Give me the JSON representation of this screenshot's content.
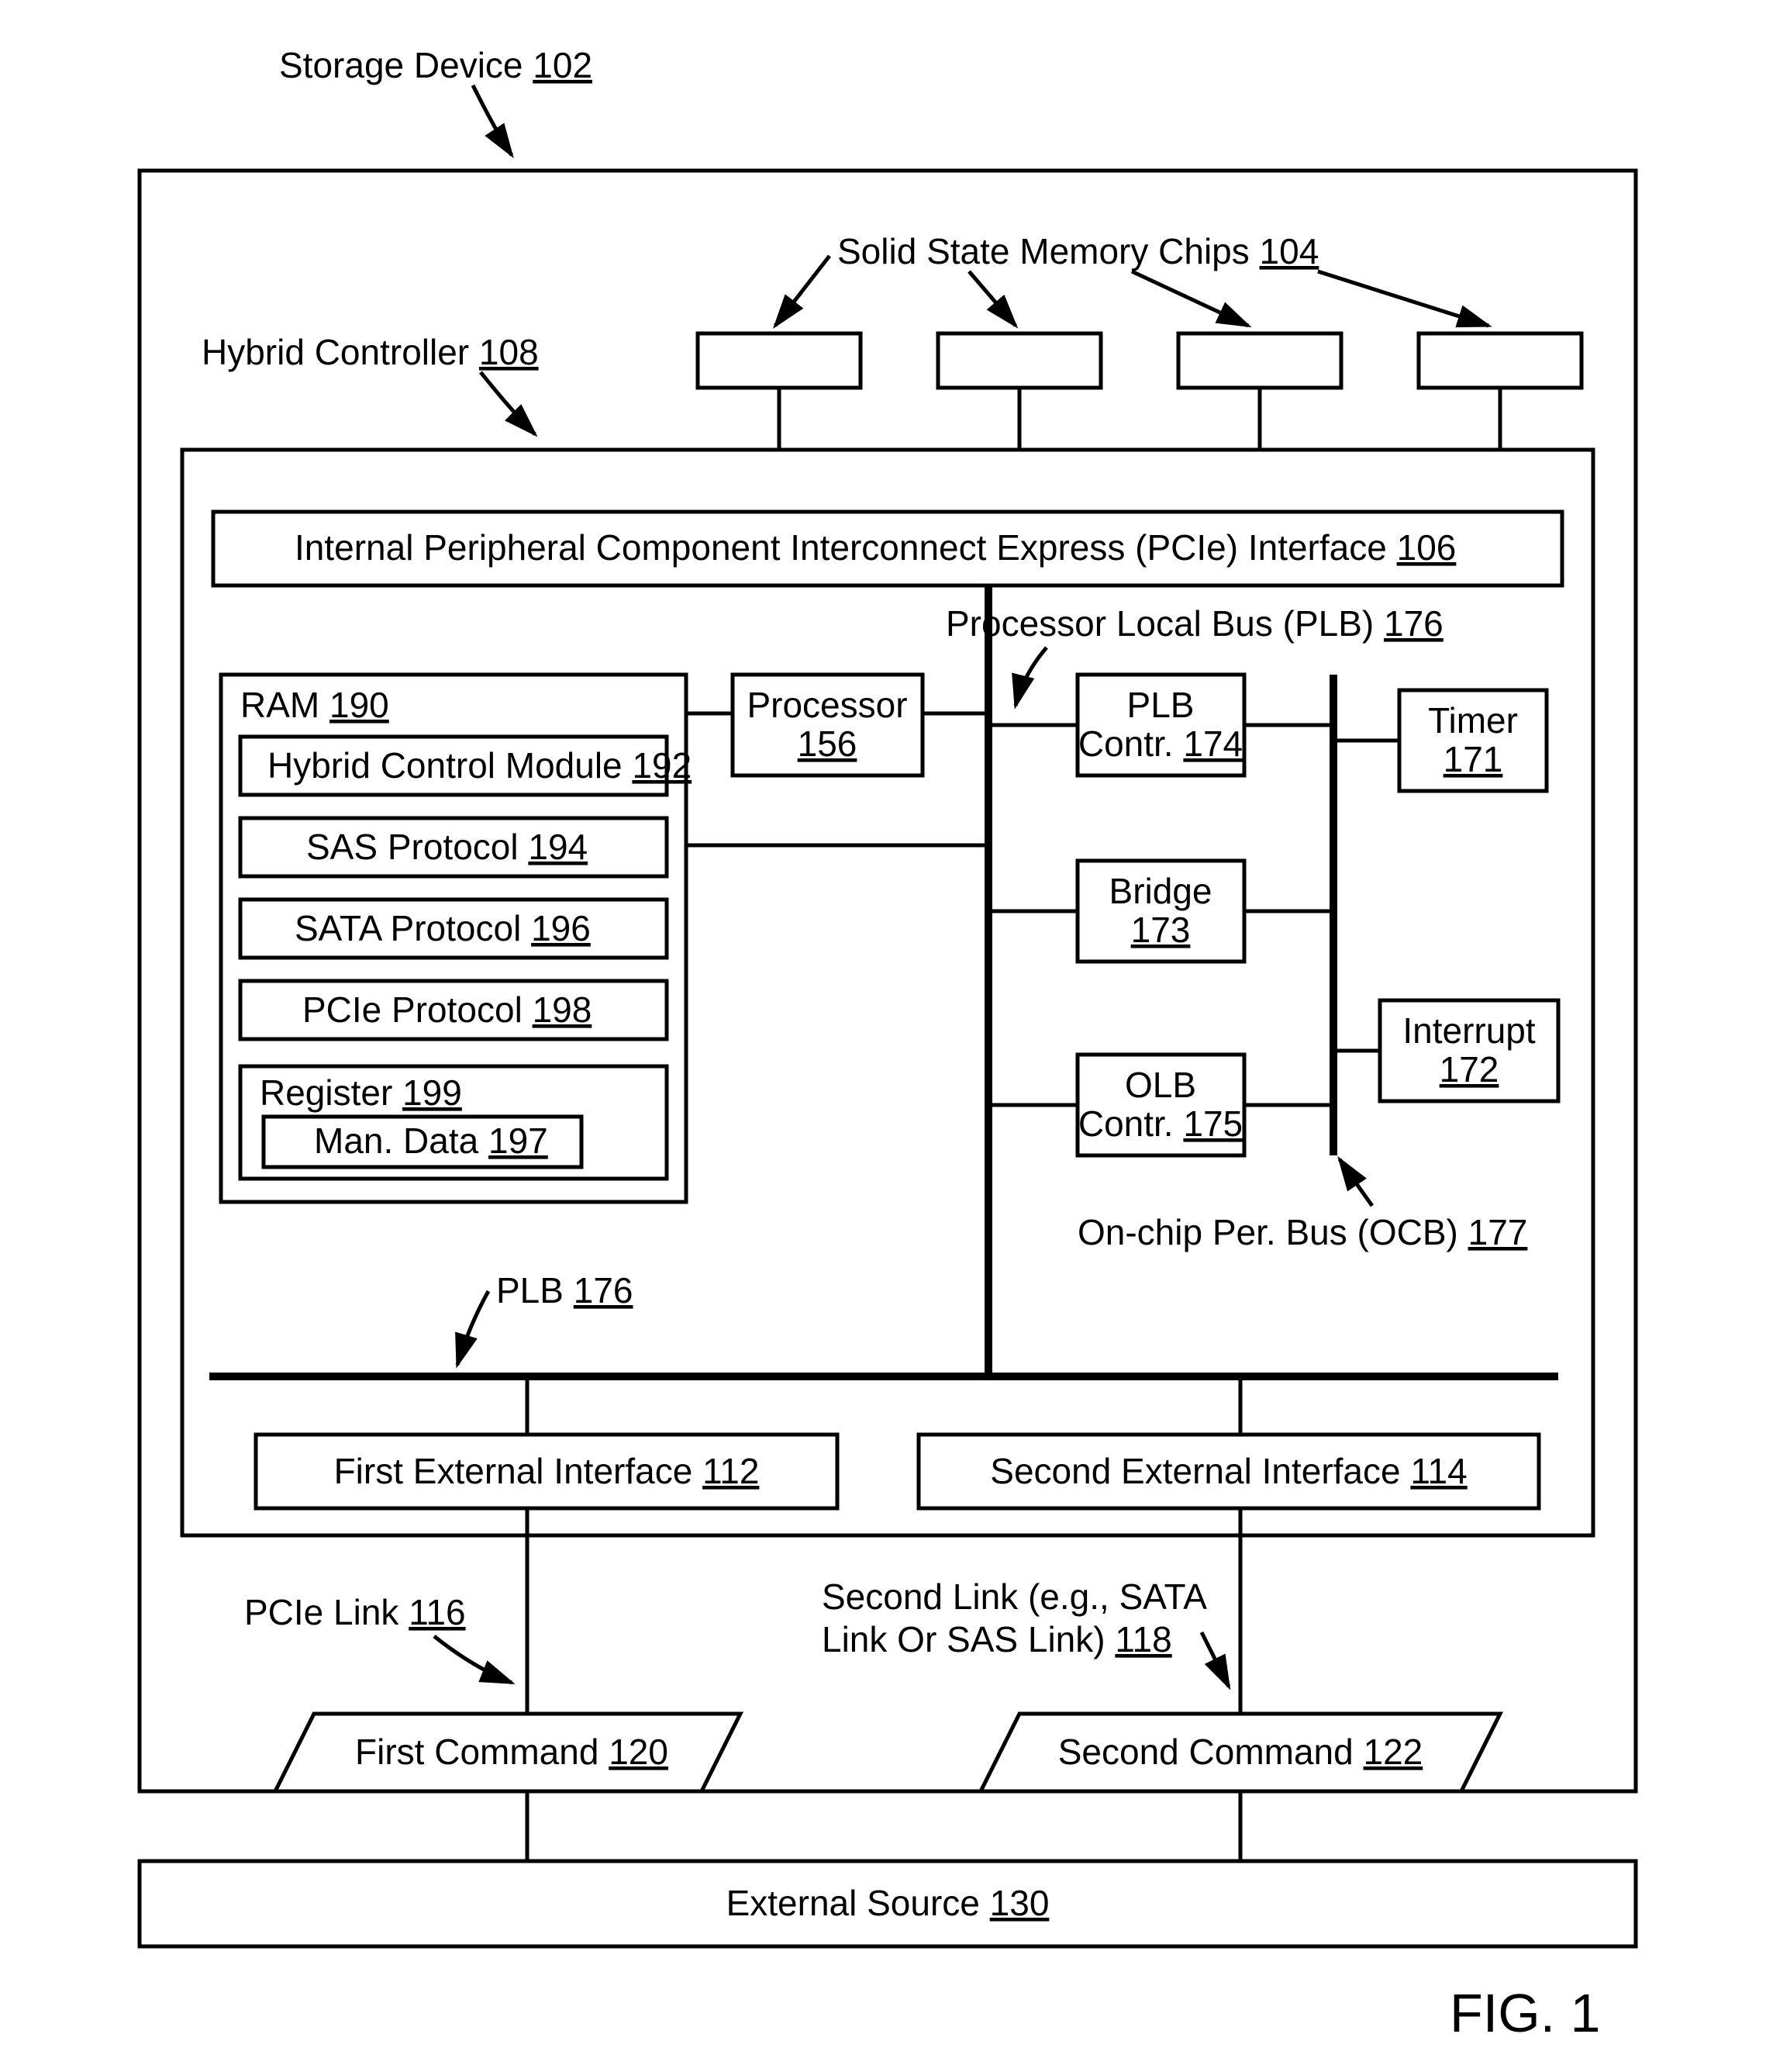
{
  "labels": {
    "storage_device": "Storage Device",
    "storage_device_ref": "102",
    "ssmc": "Solid State Memory Chips",
    "ssmc_ref": "104",
    "hybrid_controller": "Hybrid Controller",
    "hybrid_controller_ref": "108",
    "pcie_interface": "Internal Peripheral Component Interconnect Express (PCIe) Interface",
    "pcie_interface_ref": "106",
    "ram": "RAM",
    "ram_ref": "190",
    "hcm": "Hybrid Control Module",
    "hcm_ref": "192",
    "sas": "SAS Protocol",
    "sas_ref": "194",
    "sata": "SATA Protocol",
    "sata_ref": "196",
    "pcie_proto": "PCIe Protocol",
    "pcie_proto_ref": "198",
    "register": "Register",
    "register_ref": "199",
    "mandata": "Man. Data",
    "mandata_ref": "197",
    "processor": "Processor",
    "processor_ref": "156",
    "plb_label": "Processor Local Bus (PLB)",
    "plb_label_ref": "176",
    "plb_contr": "PLB",
    "plb_contr2": "Contr.",
    "plb_contr_ref": "174",
    "timer": "Timer",
    "timer_ref": "171",
    "bridge": "Bridge",
    "bridge_ref": "173",
    "interrupt": "Interrupt",
    "interrupt_ref": "172",
    "olb_contr": "OLB",
    "olb_contr2": "Contr.",
    "olb_contr_ref": "175",
    "ocb": "On-chip Per. Bus (OCB)",
    "ocb_ref": "177",
    "plb2": "PLB",
    "plb2_ref": "176",
    "first_ext": "First External Interface",
    "first_ext_ref": "112",
    "second_ext": "Second External Interface",
    "second_ext_ref": "114",
    "pcie_link": "PCIe Link",
    "pcie_link_ref": "116",
    "second_link1": "Second Link (e.g., SATA",
    "second_link2": "Link Or SAS Link)",
    "second_link_ref": "118",
    "first_cmd": "First Command",
    "first_cmd_ref": "120",
    "second_cmd": "Second Command",
    "second_cmd_ref": "122",
    "ext_src": "External Source",
    "ext_src_ref": "130",
    "fig": "FIG. 1"
  }
}
